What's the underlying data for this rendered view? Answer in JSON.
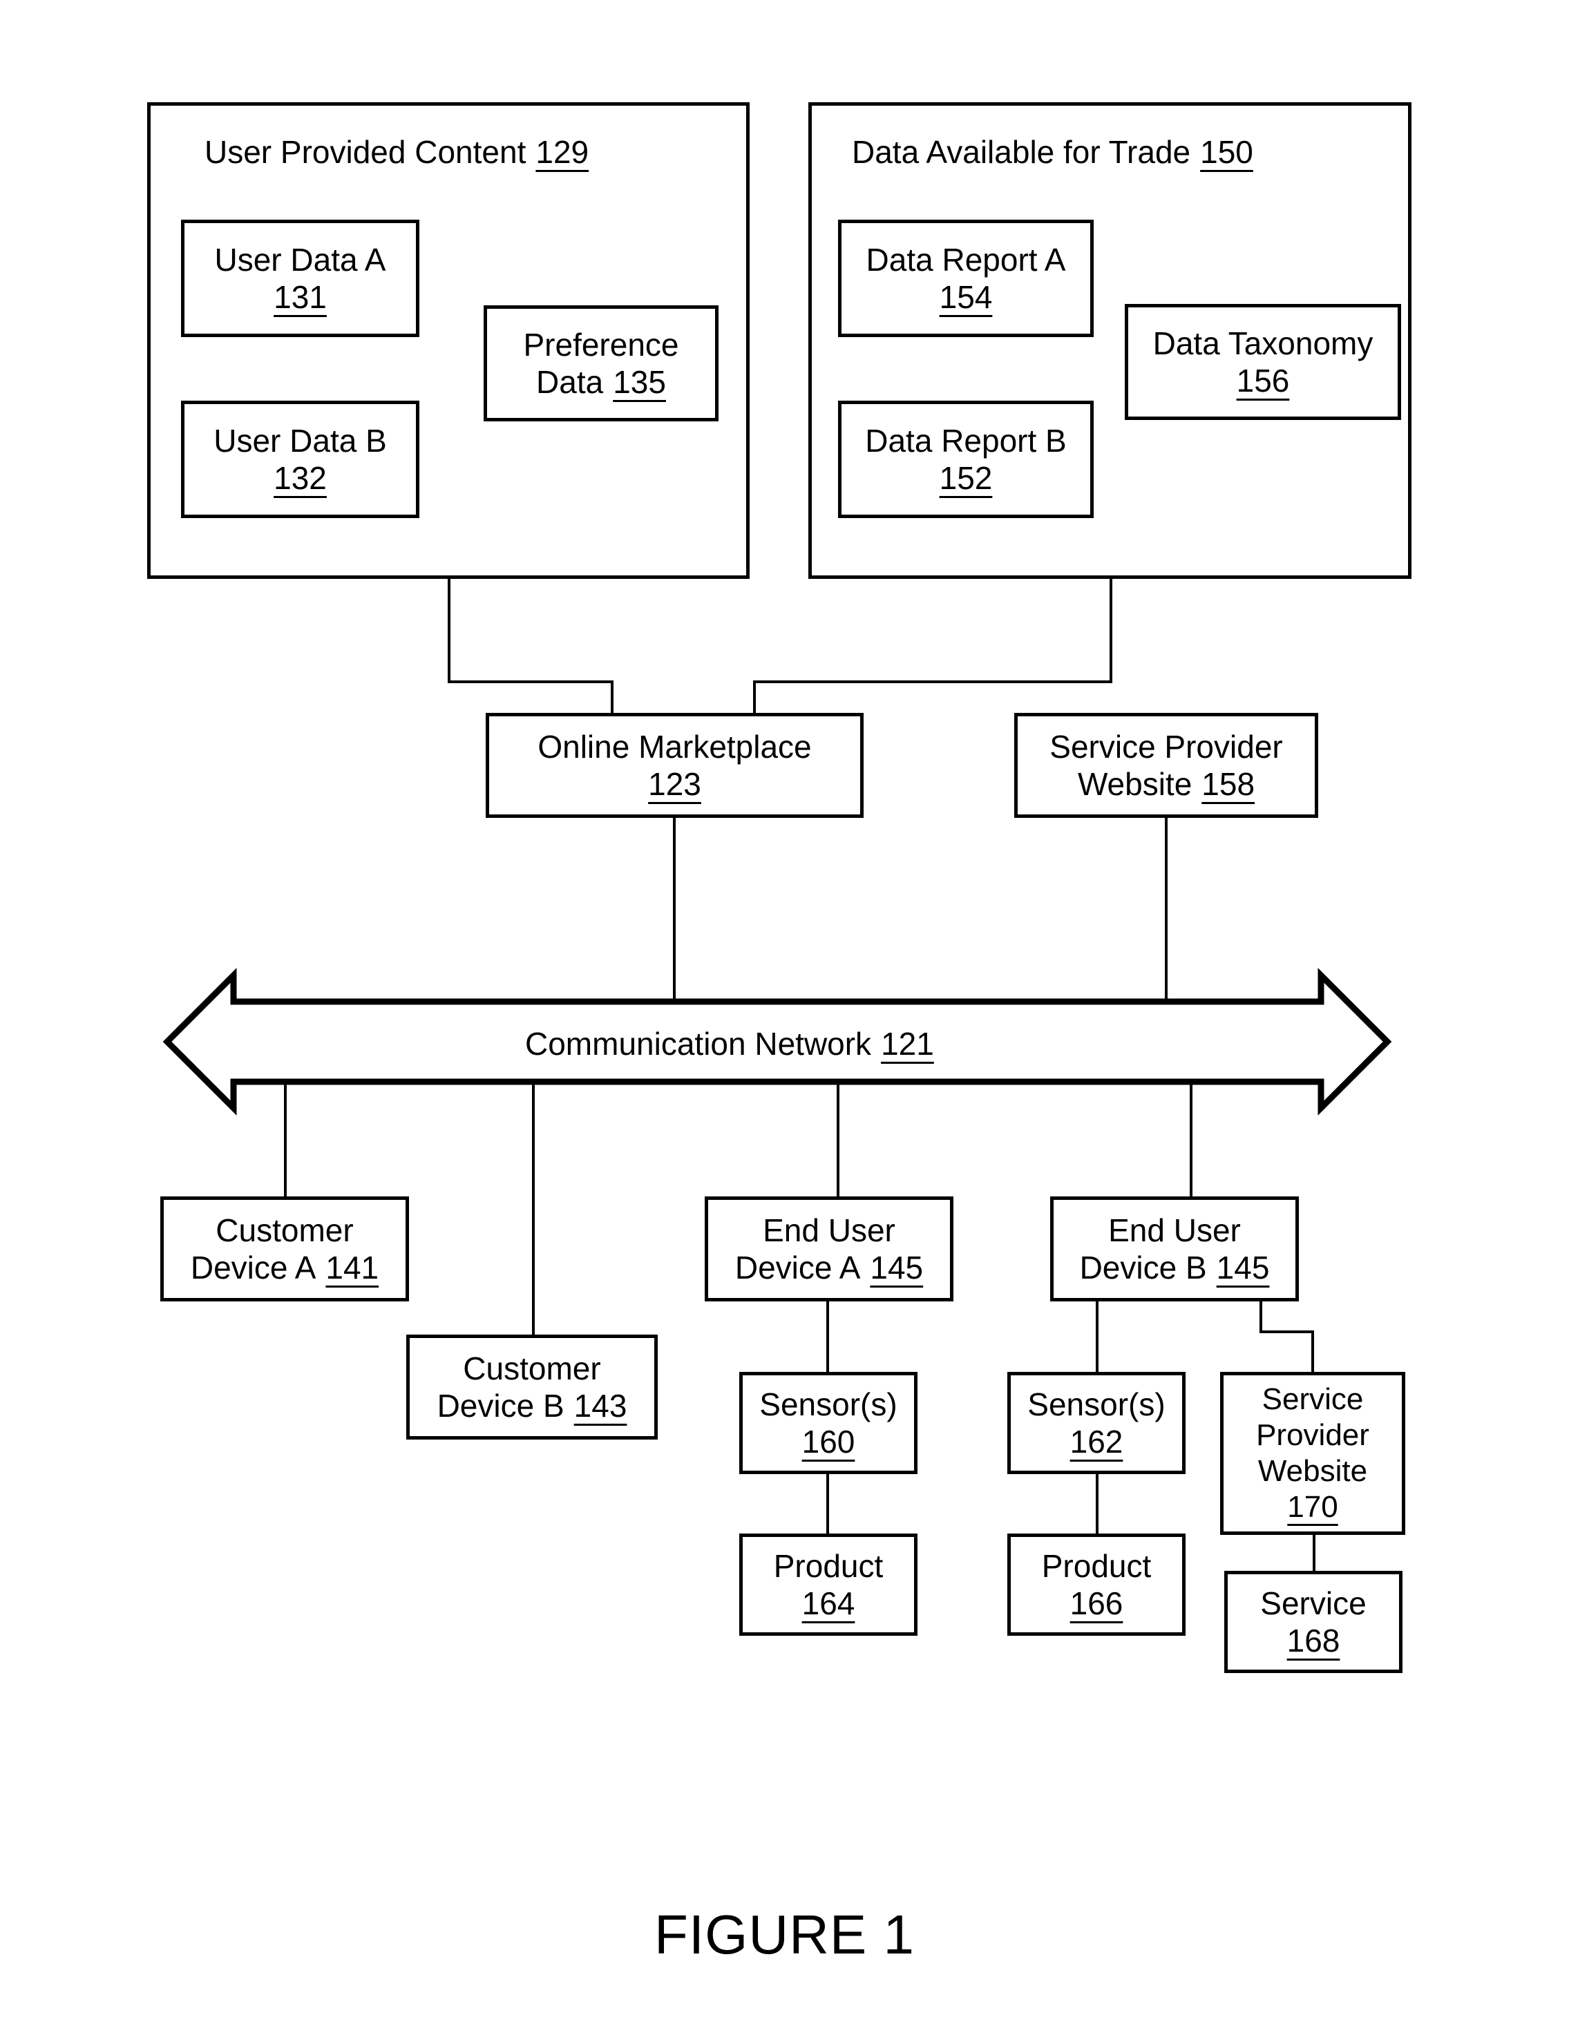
{
  "figure": {
    "caption": "FIGURE 1"
  },
  "containers": [
    {
      "id": "user-provided-content",
      "title": "User Provided Content",
      "ref": "129"
    },
    {
      "id": "data-available-for-trade",
      "title": "Data Available for Trade",
      "ref": "150"
    }
  ],
  "blocks": {
    "user_data_a": {
      "line1": "User Data A",
      "ref": "131"
    },
    "user_data_b": {
      "line1": "User Data B",
      "ref": "132"
    },
    "preference_data": {
      "line1": "Preference",
      "line2": "Data",
      "ref": "135"
    },
    "data_report_a": {
      "line1": "Data Report A",
      "ref": "154"
    },
    "data_report_b": {
      "line1": "Data Report B",
      "ref": "152"
    },
    "data_taxonomy": {
      "line1": "Data Taxonomy",
      "ref": "156"
    },
    "online_marketplace": {
      "line1": "Online Marketplace",
      "ref": "123"
    },
    "service_provider_website_158": {
      "line1": "Service Provider",
      "line2": "Website",
      "ref": "158"
    },
    "communication_network": {
      "line1": "Communication Network",
      "ref": "121"
    },
    "customer_device_a": {
      "line1": "Customer",
      "line2": "Device A",
      "ref": "141"
    },
    "customer_device_b": {
      "line1": "Customer",
      "line2": "Device B",
      "ref": "143"
    },
    "end_user_device_a": {
      "line1": "End User",
      "line2": "Device A",
      "ref": "145"
    },
    "end_user_device_b": {
      "line1": "End User",
      "line2": "Device B",
      "ref": "145"
    },
    "sensors_160": {
      "line1": "Sensor(s)",
      "ref": "160"
    },
    "sensors_162": {
      "line1": "Sensor(s)",
      "ref": "162"
    },
    "product_164": {
      "line1": "Product",
      "ref": "164"
    },
    "product_166": {
      "line1": "Product",
      "ref": "166"
    },
    "service_provider_website_170": {
      "line1": "Service",
      "line2": "Provider",
      "line3": "Website",
      "ref": "170"
    },
    "service_168": {
      "line1": "Service",
      "ref": "168"
    }
  },
  "style": {
    "line_color": "#000000",
    "background": "#ffffff"
  }
}
